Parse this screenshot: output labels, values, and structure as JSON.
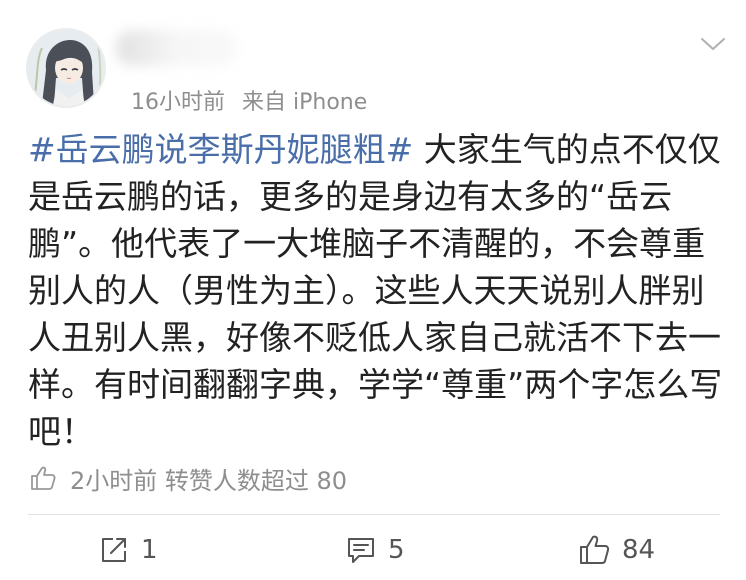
{
  "post": {
    "time": "16小时前",
    "source": "来自 iPhone",
    "hashtag": "#岳云鹏说李斯丹妮腿粗#",
    "body": " 大家生气的点不仅仅是岳云鹏的话，更多的是身边有太多的“岳云鹏”。他代表了一大堆脑子不清醒的，不会尊重别人的人（男性为主）。这些人天天说别人胖别人丑别人黑，好像不贬低人家自己就活不下去一样。有时间翻翻字典，学学“尊重”两个字怎么写吧！"
  },
  "repost_info": {
    "text": "2小时前  转赞人数超过 80"
  },
  "actions": {
    "repost_count": "1",
    "comment_count": "5",
    "like_count": "84"
  },
  "colors": {
    "hashtag": "#4a6ea9",
    "meta_gray": "#8e8e8e",
    "body_text": "#222222"
  },
  "icons": {
    "menu": "chevron-down-icon",
    "repost": "share-icon",
    "comment": "comment-icon",
    "like": "thumbs-up-icon"
  }
}
